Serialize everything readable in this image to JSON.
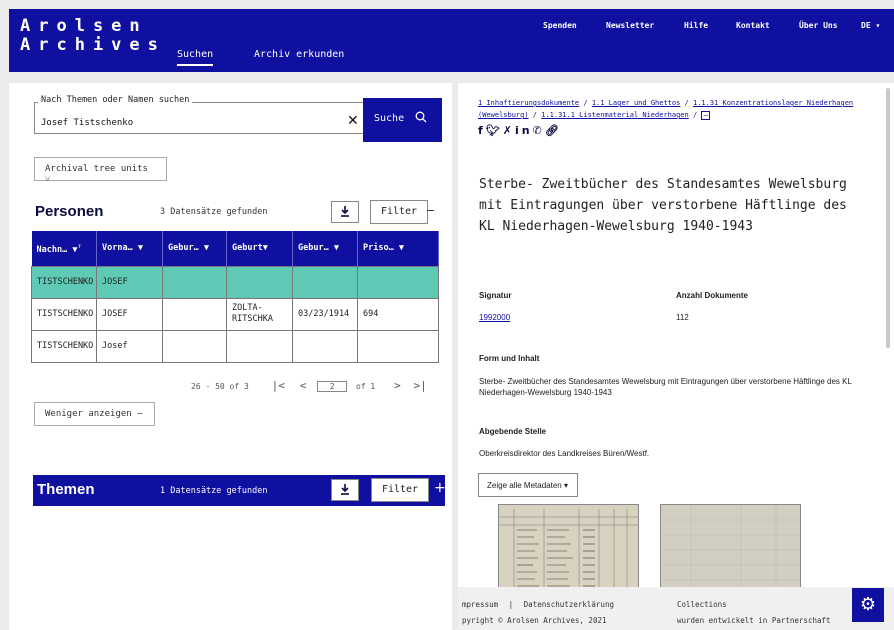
{
  "header": {
    "logo_line1": "Arolsen",
    "logo_line2": "Archives",
    "tabs": [
      {
        "label": "Suchen",
        "active": true
      },
      {
        "label": "Archiv erkunden",
        "active": false
      }
    ],
    "topnav": [
      "Spenden",
      "Newsletter",
      "Hilfe",
      "Kontakt",
      "Über Uns",
      "DE"
    ]
  },
  "search": {
    "legend": "Nach Themen oder Namen suchen",
    "value": "Josef Tistschenko",
    "button": "Suche",
    "tree_button": "Archival tree units"
  },
  "personen": {
    "title": "Personen",
    "found": "3 Datensätze gefunden",
    "filter": "Filter",
    "columns": [
      "Nachn…",
      "Vorna…",
      "Gebur…",
      "Geburt",
      "Gebur…",
      "Priso…"
    ],
    "rows": [
      [
        "TISTSCHENKO",
        "JOSEF",
        "",
        "",
        "",
        ""
      ],
      [
        "TISTSCHENKO",
        "JOSEF",
        "",
        "ZOLTA-RITSCHKA",
        "03/23/1914",
        "694"
      ],
      [
        "TISTSCHENKO",
        "Josef",
        "",
        "",
        "",
        ""
      ]
    ],
    "pager_range": "26 - 50 of 3",
    "pager_page": "2",
    "pager_of": "of 1",
    "less_button": "Weniger anzeigen"
  },
  "themen": {
    "title": "Themen",
    "found": "1 Datensätze gefunden",
    "filter": "Filter"
  },
  "detail": {
    "breadcrumb": [
      "1 Inhaftierungsdokumente",
      "1.1 Lager und Ghettos",
      "1.1.31 Konzentrationslager Niederhagen (Wewelsburg)",
      "1.1.31.1 Listenmaterial Niederhagen"
    ],
    "title": "Sterbe- Zweitbücher des Standesamtes Wewelsburg mit Eintragungen über verstorbene Häftlinge des KL Niederhagen-Wewelsburg 1940-1943",
    "signatur_label": "Signatur",
    "signatur_value": "1992000",
    "anzahl_label": "Anzahl Dokumente",
    "anzahl_value": "112",
    "form_label": "Form und Inhalt",
    "form_value": "Sterbe- Zweitbücher des Standesamtes Wewelsburg mit Eintragungen über verstorbene Häftlinge des KL Niederhagen-Wewelsburg 1940-1943",
    "stelle_label": "Abgebende Stelle",
    "stelle_value": "Oberkreisdirektor des Landkreises Büren/Westf.",
    "meta_button": "Zeige alle Metadaten"
  },
  "footer": {
    "impressum": "mpressum",
    "datenschutz": "Datenschutzerklärung",
    "copyright": "pyright © Arolsen Archives, 2021",
    "right1": "Collections",
    "right2": "wurden entwickelt in Partnerschaft"
  },
  "colors": {
    "brand": "#0f0fa0",
    "selected_row": "#5ec9b5"
  }
}
